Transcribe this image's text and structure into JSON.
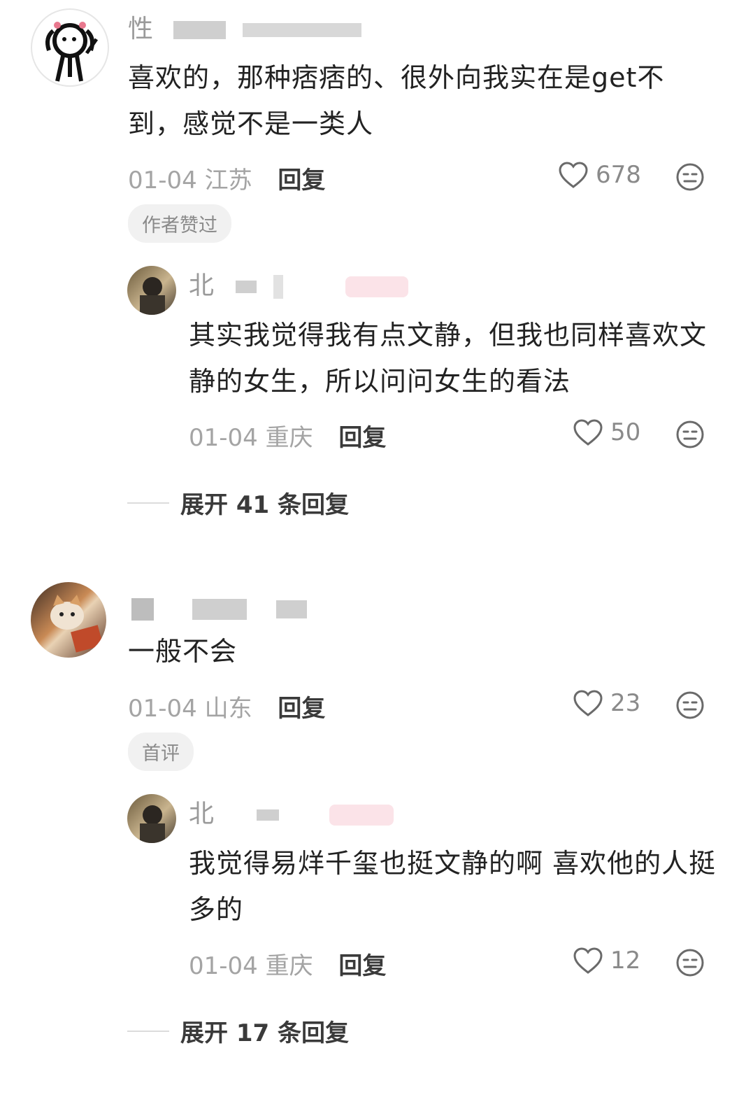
{
  "comments": [
    {
      "username": "性",
      "text": "喜欢的，那种痞痞的、很外向我实在是get不到，感觉不是一类人",
      "date": "01-04",
      "region": "江苏",
      "reply_label": "回复",
      "likes": "678",
      "badge": "作者赞过",
      "reply": {
        "username": "北",
        "text": "其实我觉得我有点文静，但我也同样喜欢文静的女生，所以问问女生的看法",
        "date": "01-04",
        "region": "重庆",
        "reply_label": "回复",
        "likes": "50"
      },
      "expand_label": "展开 41 条回复"
    },
    {
      "username": "",
      "text": "一般不会",
      "date": "01-04",
      "region": "山东",
      "reply_label": "回复",
      "likes": "23",
      "badge": "首评",
      "reply": {
        "username": "北",
        "text": "我觉得易烊千玺也挺文静的啊 喜欢他的人挺多的",
        "date": "01-04",
        "region": "重庆",
        "reply_label": "回复",
        "likes": "12"
      },
      "expand_label": "展开 17 条回复"
    }
  ],
  "icons": {
    "like": "heart-outline-icon",
    "emoji": "neutral-face-icon"
  },
  "colors": {
    "text": "#222222",
    "meta": "#a4a4a4",
    "badge_bg": "#f1f1f1"
  }
}
